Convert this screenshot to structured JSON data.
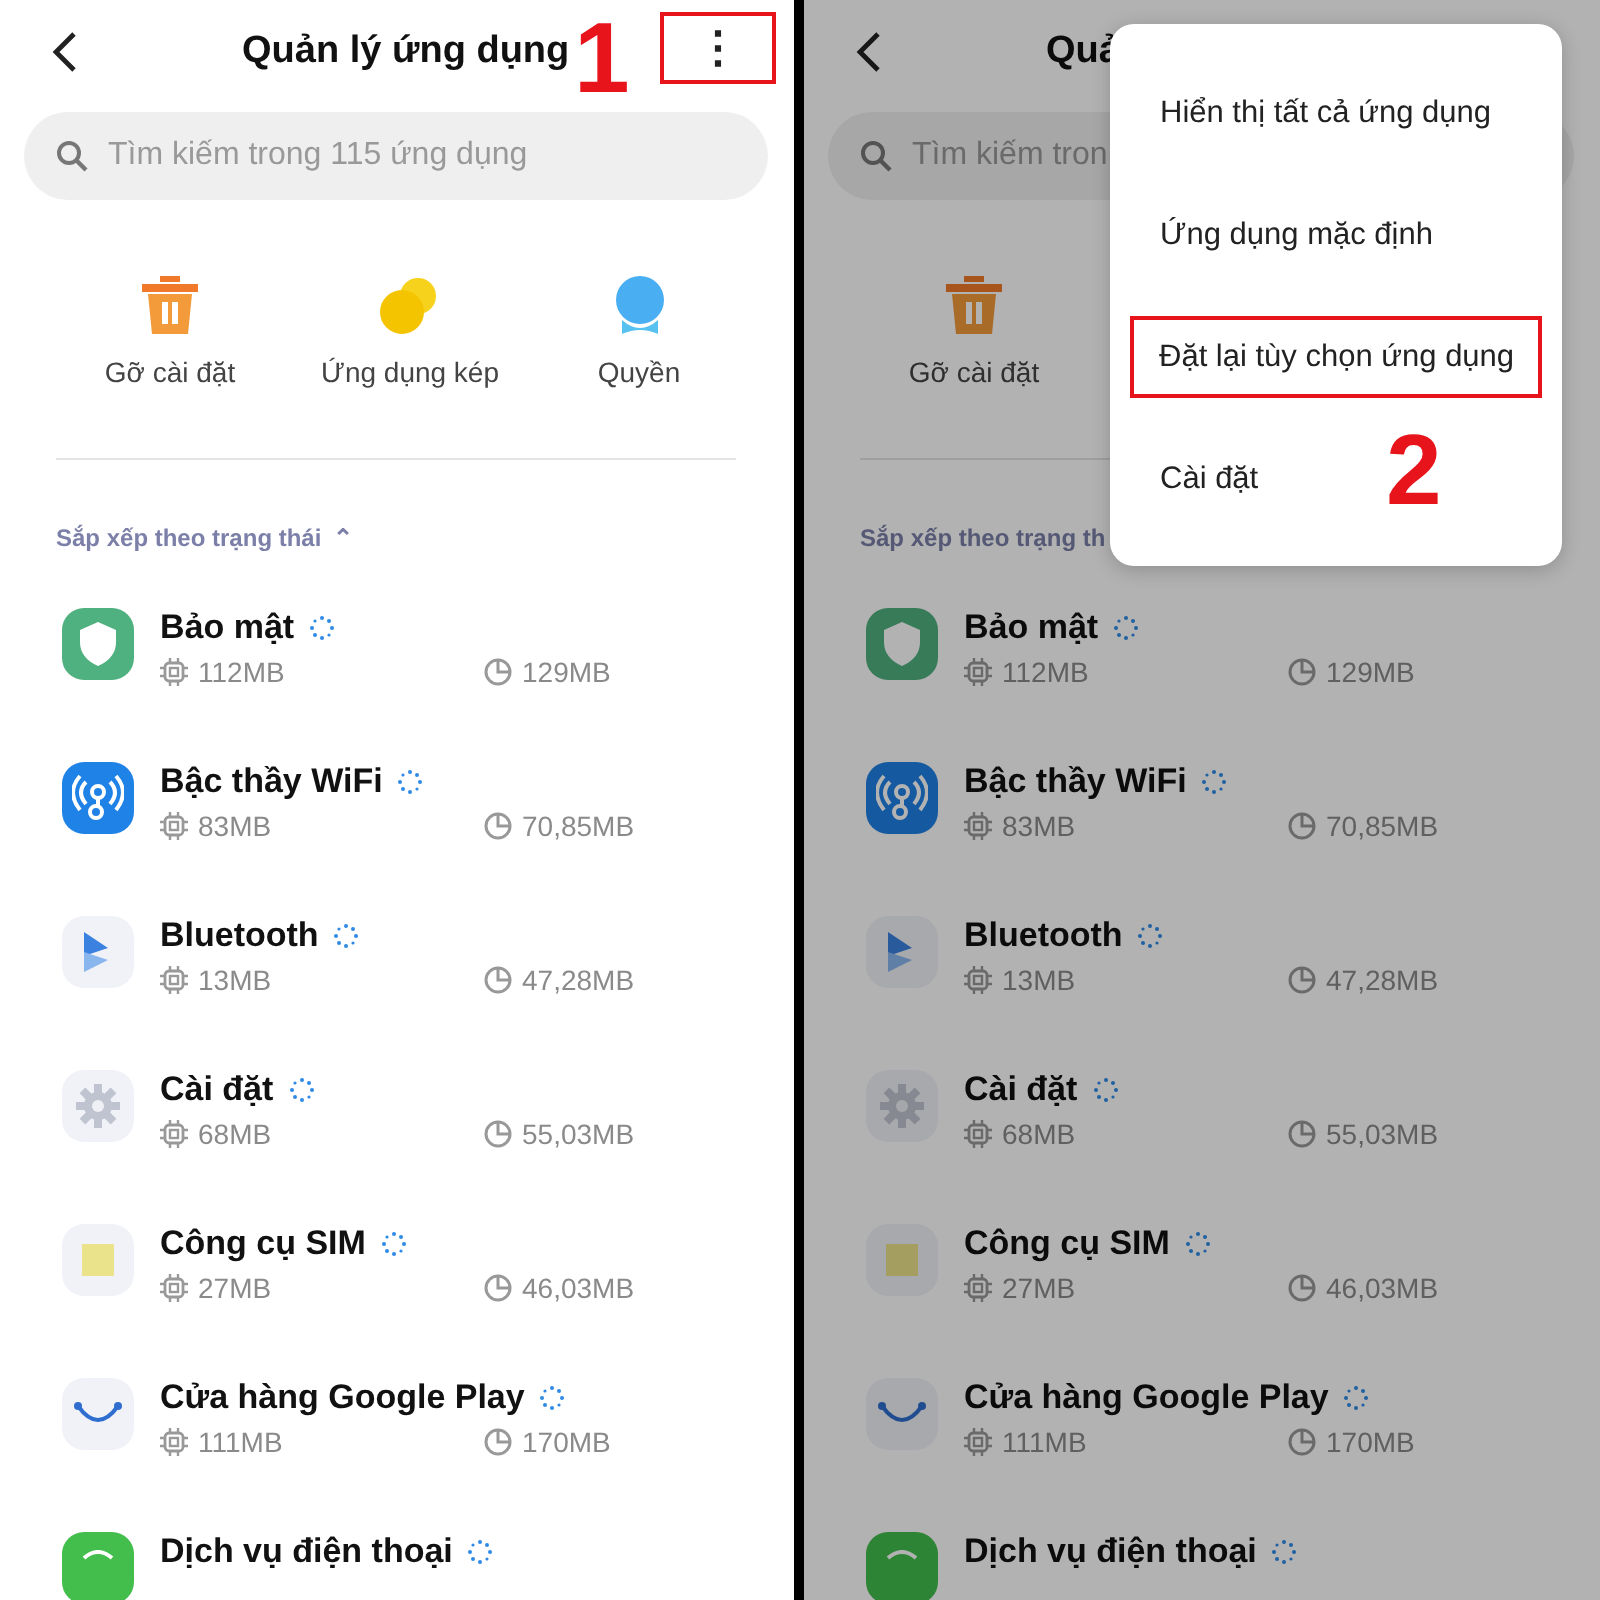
{
  "panels": [
    {
      "step": "1",
      "dimmed": false,
      "title": "Quản lý ứng dụng",
      "more_highlighted": true,
      "more_button": "⋮",
      "search": {
        "placeholder": "Tìm kiếm trong 115 ứng dụng"
      },
      "shortcuts": [
        {
          "kind": "trash",
          "label": "Gỡ cài đặt"
        },
        {
          "kind": "dual",
          "label": "Ứng dụng kép"
        },
        {
          "kind": "person",
          "label": "Quyền"
        }
      ],
      "sort_label": "Sắp xếp theo trạng thái",
      "sort_caret": "⌃",
      "apps": [
        {
          "kind": "shield",
          "name": "Bảo mật",
          "ram": "112MB",
          "cache": "129MB"
        },
        {
          "kind": "wifi",
          "name": "Bậc thầy WiFi",
          "ram": "83MB",
          "cache": "70,85MB"
        },
        {
          "kind": "play",
          "name": "Bluetooth",
          "ram": "13MB",
          "cache": "47,28MB"
        },
        {
          "kind": "gear",
          "name": "Cài đặt",
          "ram": "68MB",
          "cache": "55,03MB"
        },
        {
          "kind": "sim",
          "name": "Công cụ SIM",
          "ram": "27MB",
          "cache": "46,03MB"
        },
        {
          "kind": "store",
          "name": "Cửa hàng Google Play",
          "ram": "111MB",
          "cache": "170MB"
        },
        {
          "kind": "phone",
          "name": "Dịch vụ điện thoại"
        }
      ]
    },
    {
      "step": "2",
      "dimmed": true,
      "title": "Quả",
      "search": {
        "placeholder": "Tìm kiếm tron"
      },
      "shortcuts": [
        {
          "kind": "trash",
          "label": "Gỡ cài đặt"
        }
      ],
      "sort_label": "Sắp xếp theo trạng th",
      "apps": [
        {
          "kind": "shield",
          "name": "Bảo mật",
          "ram": "112MB",
          "cache": "129MB"
        },
        {
          "kind": "wifi",
          "name": "Bậc thầy WiFi",
          "ram": "83MB",
          "cache": "70,85MB"
        },
        {
          "kind": "play",
          "name": "Bluetooth",
          "ram": "13MB",
          "cache": "47,28MB"
        },
        {
          "kind": "gear",
          "name": "Cài đặt",
          "ram": "68MB",
          "cache": "55,03MB"
        },
        {
          "kind": "sim",
          "name": "Công cụ SIM",
          "ram": "27MB",
          "cache": "46,03MB"
        },
        {
          "kind": "store",
          "name": "Cửa hàng Google Play",
          "ram": "111MB",
          "cache": "170MB"
        },
        {
          "kind": "phone",
          "name": "Dịch vụ điện thoại"
        }
      ],
      "menu": [
        {
          "label": "Hiển thị tất cả ứng dụng",
          "highlighted": false
        },
        {
          "label": "Ứng dụng mặc định",
          "highlighted": false
        },
        {
          "label": "Đặt lại tùy chọn ứng dụng",
          "highlighted": true
        },
        {
          "label": "Cài đặt",
          "highlighted": false
        }
      ]
    }
  ]
}
